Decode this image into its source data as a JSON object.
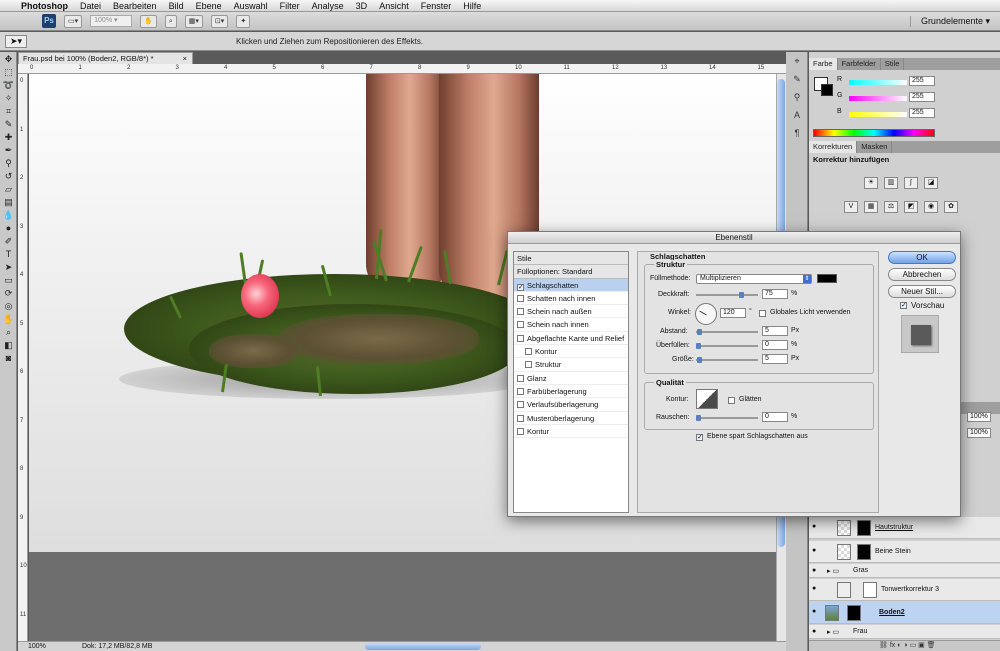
{
  "menubar": {
    "app": "Photoshop",
    "items": [
      "Datei",
      "Bearbeiten",
      "Bild",
      "Ebene",
      "Auswahl",
      "Filter",
      "Analyse",
      "3D",
      "Ansicht",
      "Fenster",
      "Hilfe"
    ]
  },
  "appbar": {
    "logo": "Ps",
    "zoom": "100% ▾",
    "workspace": "Grundelemente ▾"
  },
  "options": {
    "hint": "Klicken und Ziehen zum Repositionieren des Effekts."
  },
  "document": {
    "tab_title": "Frau.psd bei 100% (Boden2, RGB/8*) *",
    "tab_close": "×",
    "ruler_numbers": [
      "0",
      "1",
      "2",
      "3",
      "4",
      "5",
      "6",
      "7",
      "8",
      "9",
      "10",
      "11",
      "12",
      "13",
      "14",
      "15"
    ],
    "status_zoom": "100%",
    "status_doc": "Dok: 17,2 MB/82,8 MB"
  },
  "color_panel": {
    "tabs": [
      "Farbe",
      "Farbfelder",
      "Stile"
    ],
    "channels": [
      {
        "label": "R",
        "value": "255"
      },
      {
        "label": "G",
        "value": "255"
      },
      {
        "label": "B",
        "value": "255"
      }
    ]
  },
  "adjust_panel": {
    "tabs": [
      "Korrekturen",
      "Masken"
    ],
    "title": "Korrektur hinzufügen"
  },
  "layers_panel": {
    "opacity": "100%",
    "fill": "100%",
    "layers": [
      {
        "name": "Hautstruktur"
      },
      {
        "name": "Beine Stein"
      },
      {
        "name": "Gras"
      },
      {
        "name": "Tonwertkorrektur 3"
      },
      {
        "name": "Boden2"
      },
      {
        "name": "Frau"
      }
    ]
  },
  "dialog": {
    "title": "Ebenenstil",
    "styles_header": "Stile",
    "fill_options": "Fülloptionen: Standard",
    "effects": [
      {
        "label": "Schlagschatten",
        "checked": true
      },
      {
        "label": "Schatten nach innen",
        "checked": false
      },
      {
        "label": "Schein nach außen",
        "checked": false
      },
      {
        "label": "Schein nach innen",
        "checked": false
      },
      {
        "label": "Abgeflachte Kante und Relief",
        "checked": false
      },
      {
        "label": "Kontur",
        "checked": false,
        "sub": true
      },
      {
        "label": "Struktur",
        "checked": false,
        "sub": true
      },
      {
        "label": "Glanz",
        "checked": false
      },
      {
        "label": "Farbüberlagerung",
        "checked": false
      },
      {
        "label": "Verlaufsüberlagerung",
        "checked": false
      },
      {
        "label": "Musterüberlagerung",
        "checked": false
      },
      {
        "label": "Kontur",
        "checked": false
      }
    ],
    "section_title": "Schlagschatten",
    "structure_title": "Struktur",
    "blend_mode_label": "Füllmethode:",
    "blend_mode": "Multiplizieren",
    "opacity_label": "Deckkraft:",
    "opacity_value": "75",
    "angle_label": "Winkel:",
    "angle_value": "120",
    "angle_unit": "°",
    "global_light": "Globales Licht verwenden",
    "distance_label": "Abstand:",
    "distance_value": "5",
    "spread_label": "Überfüllen:",
    "spread_value": "0",
    "size_label": "Größe:",
    "size_value": "5",
    "quality_title": "Qualität",
    "contour_label": "Kontur:",
    "antialias": "Glätten",
    "noise_label": "Rauschen:",
    "noise_value": "0",
    "knockout": "Ebene spart Schlagschatten aus",
    "unit_px": "Px",
    "unit_pct": "%",
    "ok": "OK",
    "cancel": "Abbrechen",
    "new_style": "Neuer Stil...",
    "preview": "Vorschau"
  },
  "colors": {
    "selection": "#bcd4f2",
    "accent": "#3c6fd8"
  }
}
